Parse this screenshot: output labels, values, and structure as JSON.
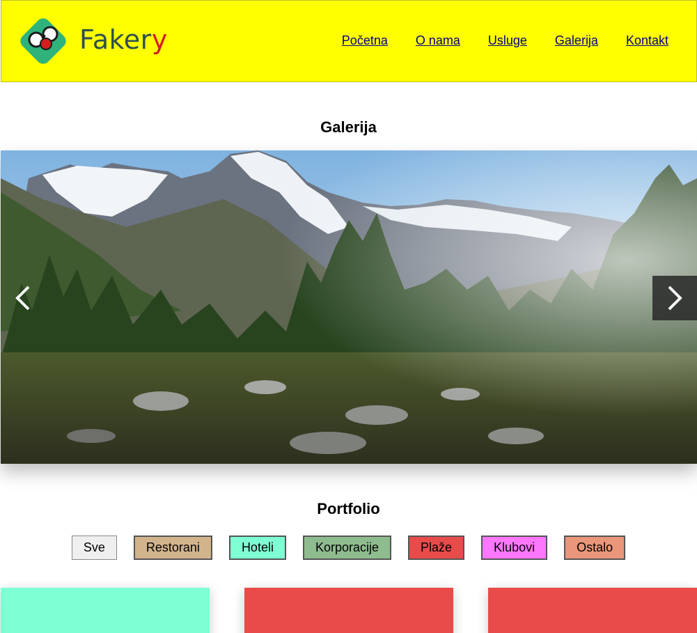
{
  "logo": {
    "text_main": "Faker",
    "text_accent": "y",
    "icon": "glasses-logo-icon",
    "colors": {
      "tile": "#2fb37b",
      "accent": "#d21f1f"
    }
  },
  "nav": {
    "items": [
      {
        "label": "Početna"
      },
      {
        "label": "O nama"
      },
      {
        "label": "Usluge"
      },
      {
        "label": "Galerija"
      },
      {
        "label": "Kontakt"
      }
    ]
  },
  "gallery": {
    "title": "Galerija",
    "image": "mountain-landscape-photo",
    "prev_icon": "chevron-left-icon",
    "next_icon": "chevron-right-icon"
  },
  "portfolio": {
    "title": "Portfolio",
    "filters": [
      {
        "label": "Sve",
        "color": "#efefef",
        "active": true
      },
      {
        "label": "Restorani",
        "color": "#d2b48c"
      },
      {
        "label": "Hoteli",
        "color": "#7fffd4"
      },
      {
        "label": "Korporacije",
        "color": "#8fbc8f"
      },
      {
        "label": "Plaže",
        "color": "#e94b4b"
      },
      {
        "label": "Klubovi",
        "color": "#ff77ff"
      },
      {
        "label": "Ostalo",
        "color": "#e9967a"
      }
    ],
    "cards": [
      {
        "color": "#7fffd4"
      },
      {
        "color": "#e94b4b"
      },
      {
        "color": "#e94b4b"
      }
    ]
  },
  "colors": {
    "header_bg": "#ffff00",
    "link": "#000080"
  }
}
